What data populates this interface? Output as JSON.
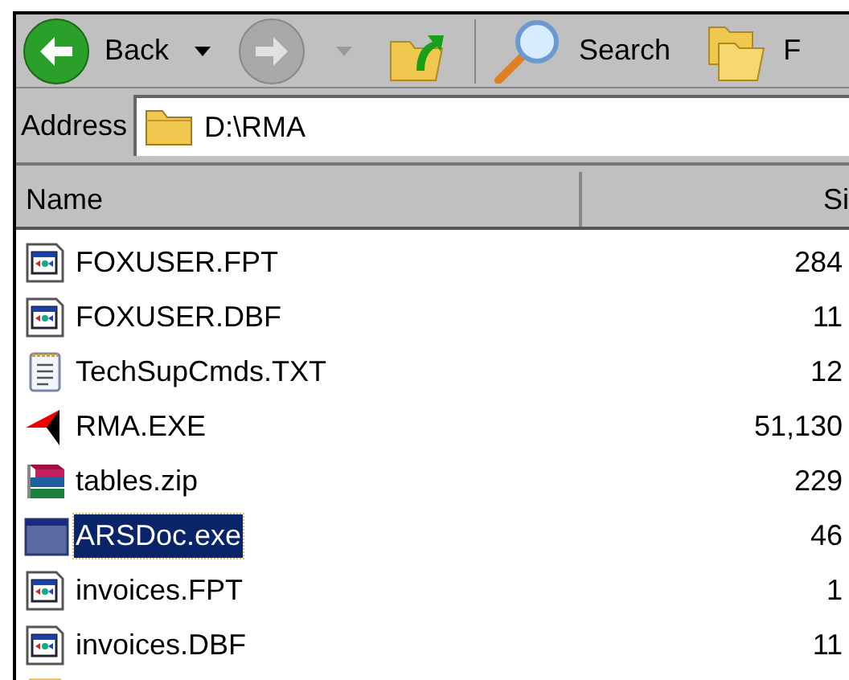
{
  "toolbar": {
    "back": "Back",
    "search": "Search",
    "folders": "F"
  },
  "address": {
    "label": "Address",
    "value": "D:\\RMA"
  },
  "columns": [
    "Name",
    "Si"
  ],
  "files": [
    {
      "kind": "foxpro",
      "name": "FOXUSER.FPT",
      "size": "284",
      "selected": false
    },
    {
      "kind": "foxpro",
      "name": "FOXUSER.DBF",
      "size": "11",
      "selected": false
    },
    {
      "kind": "text",
      "name": "TechSupCmds.TXT",
      "size": "12",
      "selected": false
    },
    {
      "kind": "rma",
      "name": "RMA.EXE",
      "size": "51,130",
      "selected": false
    },
    {
      "kind": "archive",
      "name": "tables.zip",
      "size": "229",
      "selected": false
    },
    {
      "kind": "exe",
      "name": "ARSDoc.exe",
      "size": "46",
      "selected": true
    },
    {
      "kind": "foxpro",
      "name": "invoices.FPT",
      "size": "1",
      "selected": false
    },
    {
      "kind": "foxpro",
      "name": "invoices.DBF",
      "size": "11",
      "selected": false
    }
  ]
}
